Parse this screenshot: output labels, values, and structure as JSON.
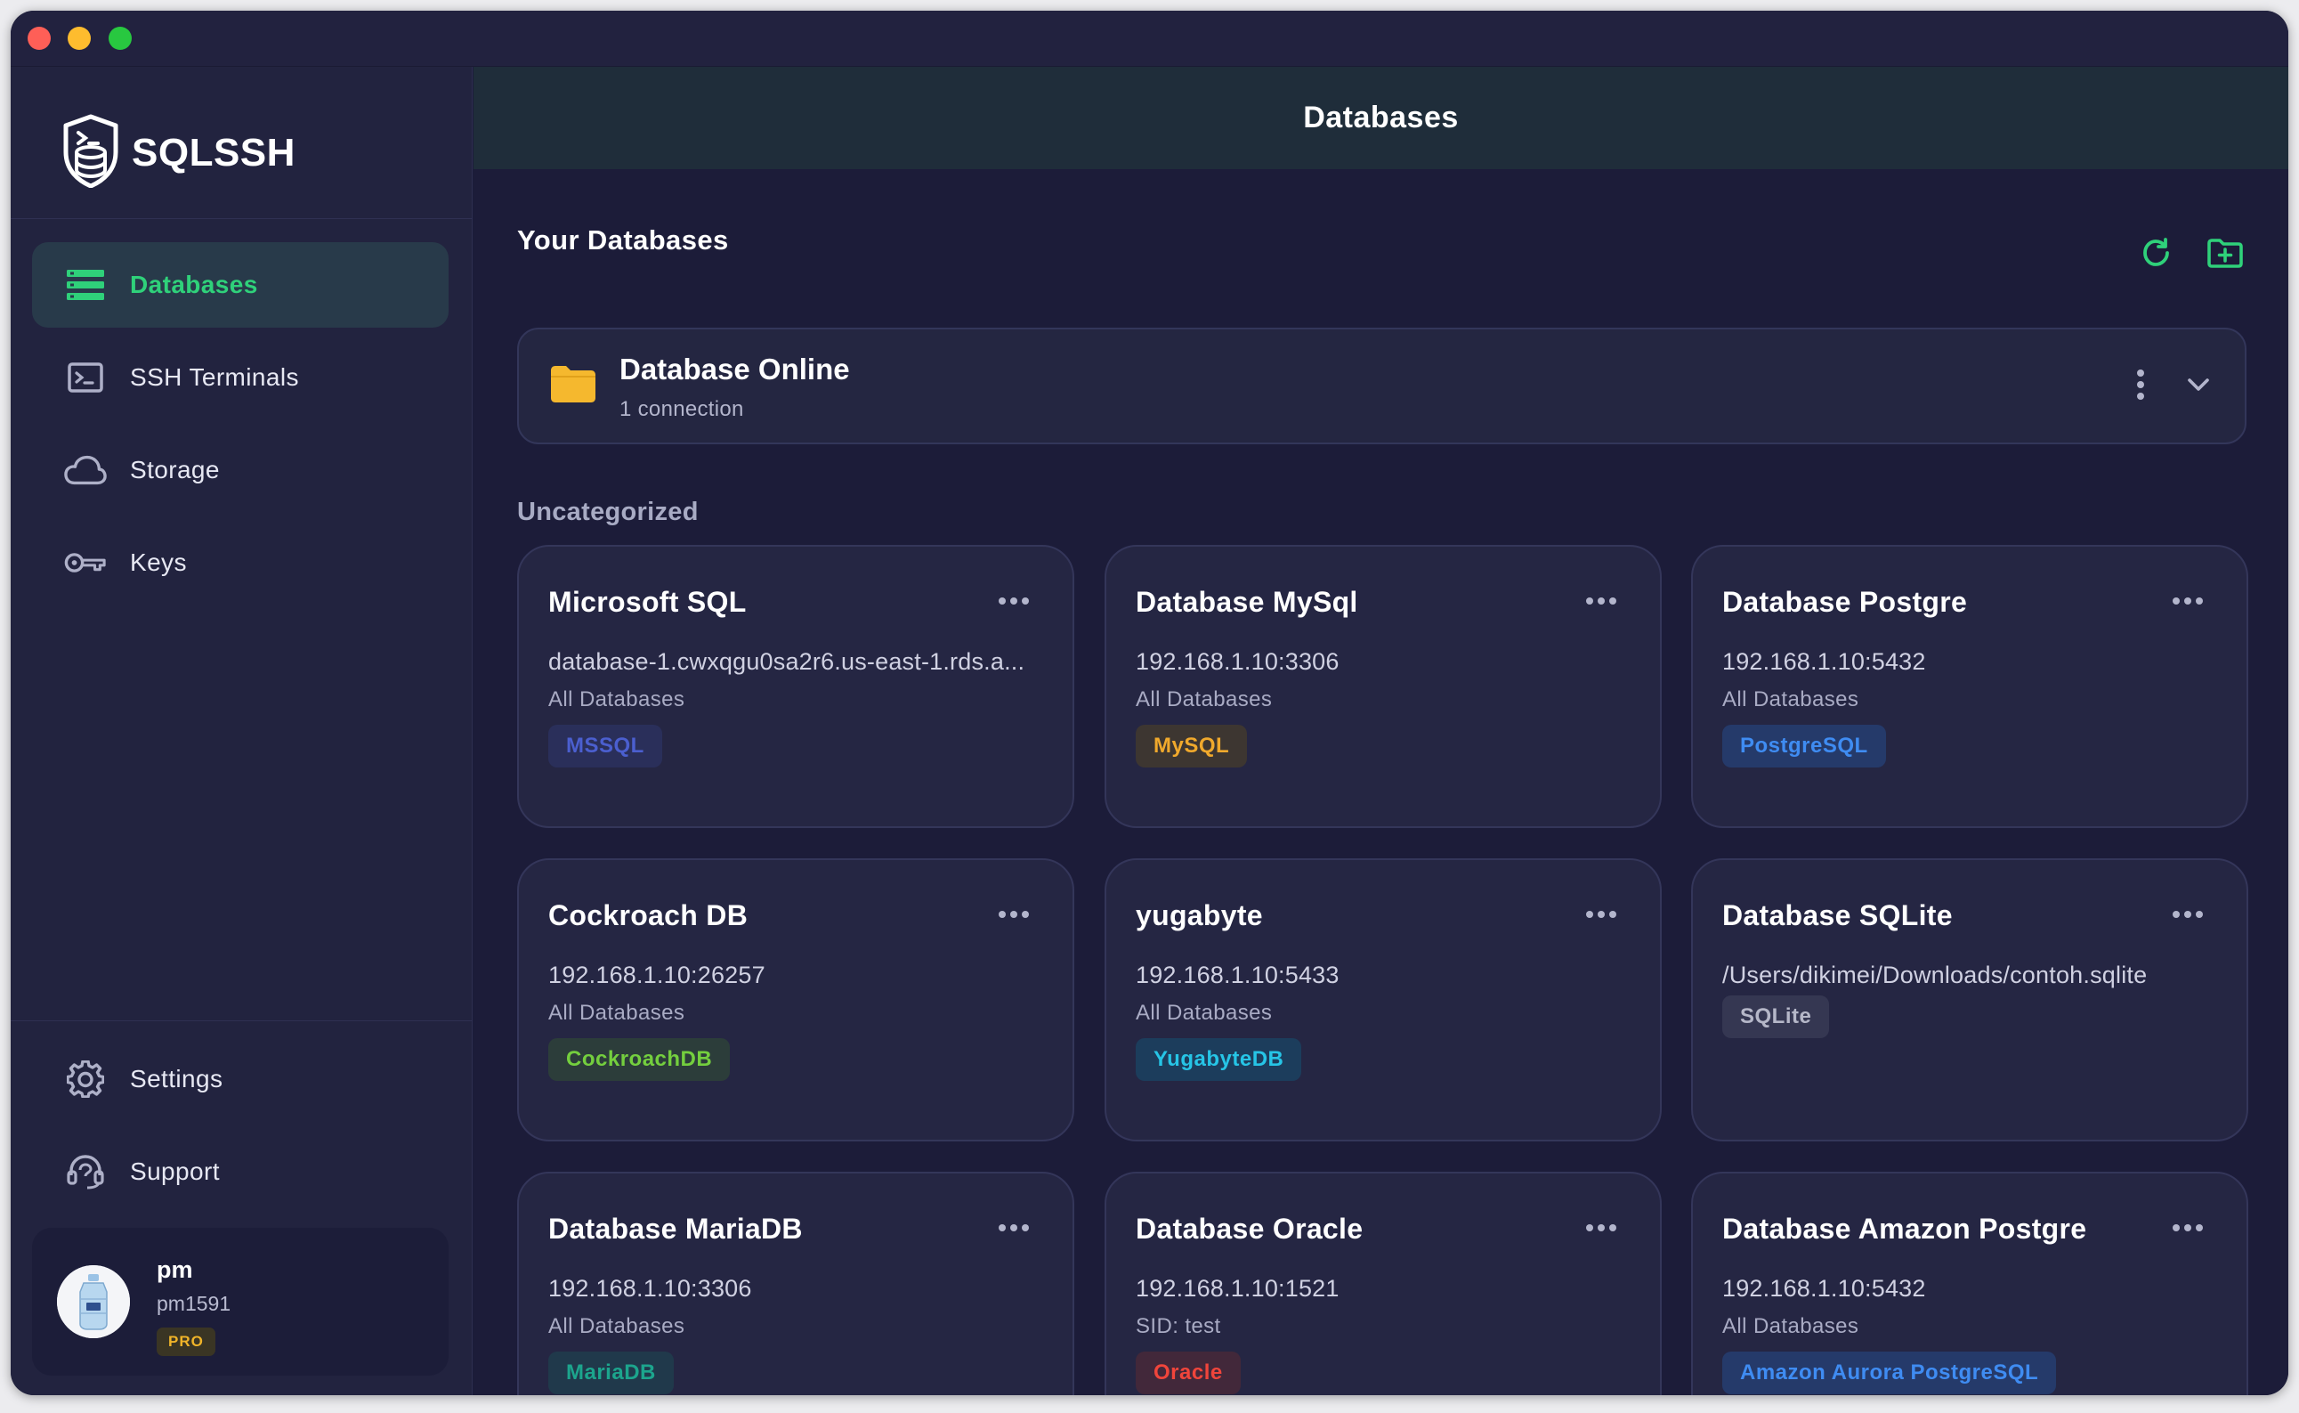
{
  "app": {
    "name": "SQLSSH"
  },
  "header": {
    "title": "Databases"
  },
  "sidebar": {
    "items": [
      {
        "label": "Databases",
        "icon": "database-list-icon",
        "active": true
      },
      {
        "label": "SSH Terminals",
        "icon": "terminal-icon",
        "active": false
      },
      {
        "label": "Storage",
        "icon": "cloud-icon",
        "active": false
      },
      {
        "label": "Keys",
        "icon": "key-icon",
        "active": false
      }
    ],
    "bottom_items": [
      {
        "label": "Settings",
        "icon": "gear-icon"
      },
      {
        "label": "Support",
        "icon": "headset-icon"
      }
    ],
    "user": {
      "name": "pm",
      "handle": "pm1591",
      "plan": "PRO"
    }
  },
  "main": {
    "section_title": "Your Databases",
    "actions": [
      {
        "label": "refresh",
        "icon": "refresh-icon"
      },
      {
        "label": "new folder",
        "icon": "folder-add-icon"
      }
    ],
    "folder": {
      "name": "Database Online",
      "count": "1 connection"
    },
    "group_label": "Uncategorized",
    "connections": [
      {
        "name": "Microsoft SQL",
        "host": "database-1.cwxqgu0sa2r6.us-east-1.rds.a...",
        "sub": "All Databases",
        "badge": "MSSQL",
        "badge_color": "#4b5fcf",
        "badge_bg": "#2a2f5a"
      },
      {
        "name": "Database MySql",
        "host": "192.168.1.10:3306",
        "sub": "All Databases",
        "badge": "MySQL",
        "badge_color": "#f0a92c",
        "badge_bg": "#3d3631"
      },
      {
        "name": "Database Postgre",
        "host": "192.168.1.10:5432",
        "sub": "All Databases",
        "badge": "PostgreSQL",
        "badge_color": "#3f8cf2",
        "badge_bg": "#253a6a"
      },
      {
        "name": "Cockroach DB",
        "host": "192.168.1.10:26257",
        "sub": "All Databases",
        "badge": "CockroachDB",
        "badge_color": "#74cf3e",
        "badge_bg": "#2c3d3a"
      },
      {
        "name": "yugabyte",
        "host": "192.168.1.10:5433",
        "sub": "All Databases",
        "badge": "YugabyteDB",
        "badge_color": "#26c5e6",
        "badge_bg": "#1c3d5c"
      },
      {
        "name": "Database SQLite",
        "host": "/Users/dikimei/Downloads/contoh.sqlite",
        "sub": "",
        "badge": "SQLite",
        "badge_color": "#b5b7c8",
        "badge_bg": "#353752"
      },
      {
        "name": "Database MariaDB",
        "host": "192.168.1.10:3306",
        "sub": "All Databases",
        "badge": "MariaDB",
        "badge_color": "#1ca58d",
        "badge_bg": "#20394b"
      },
      {
        "name": "Database Oracle",
        "host": "192.168.1.10:1521",
        "sub": "SID: test",
        "badge": "Oracle",
        "badge_color": "#f0453b",
        "badge_bg": "#42283a"
      },
      {
        "name": "Database Amazon Postgre",
        "host": "192.168.1.10:5432",
        "sub": "All Databases",
        "badge": "Amazon Aurora PostgreSQL",
        "badge_color": "#3f8cf2",
        "badge_bg": "#253a6a"
      }
    ]
  },
  "colors": {
    "accent": "#2fd17a",
    "folder": "#f5b82e"
  }
}
